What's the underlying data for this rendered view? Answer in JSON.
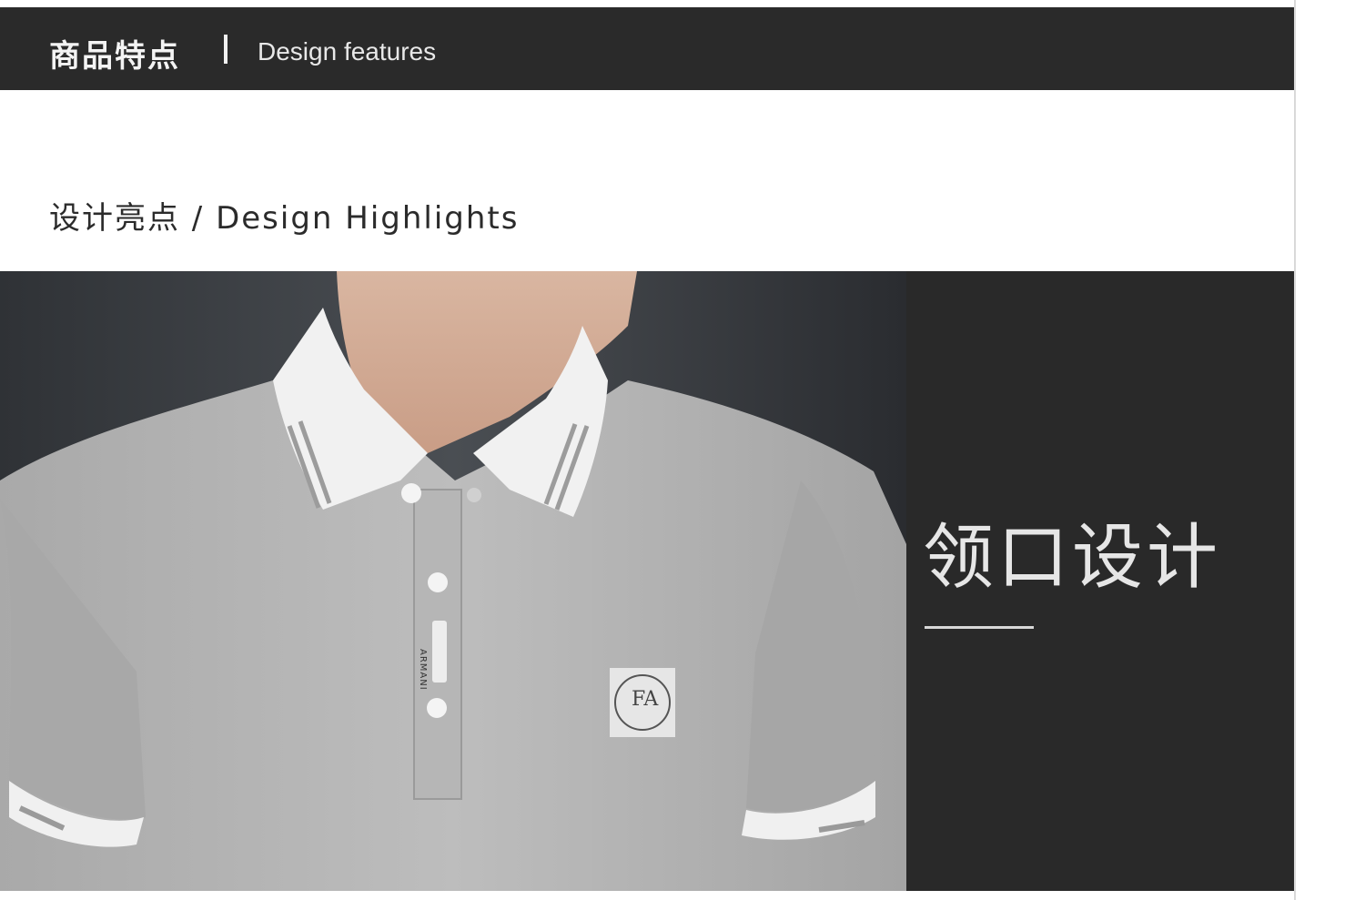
{
  "header": {
    "title_cn": "商品特点",
    "separator": "|",
    "title_en": "Design features"
  },
  "section": {
    "heading": "设计亮点 / Design Highlights"
  },
  "product_photo": {
    "label_tag_text": "ARMANI",
    "badge_text": "FA"
  },
  "caption": {
    "text": "领口设计"
  },
  "colors": {
    "dark_band": "#2a2a2a",
    "shirt_gray": "#b3b3b3",
    "collar_white": "#f2f2f2",
    "panel_dark": "#292929"
  }
}
